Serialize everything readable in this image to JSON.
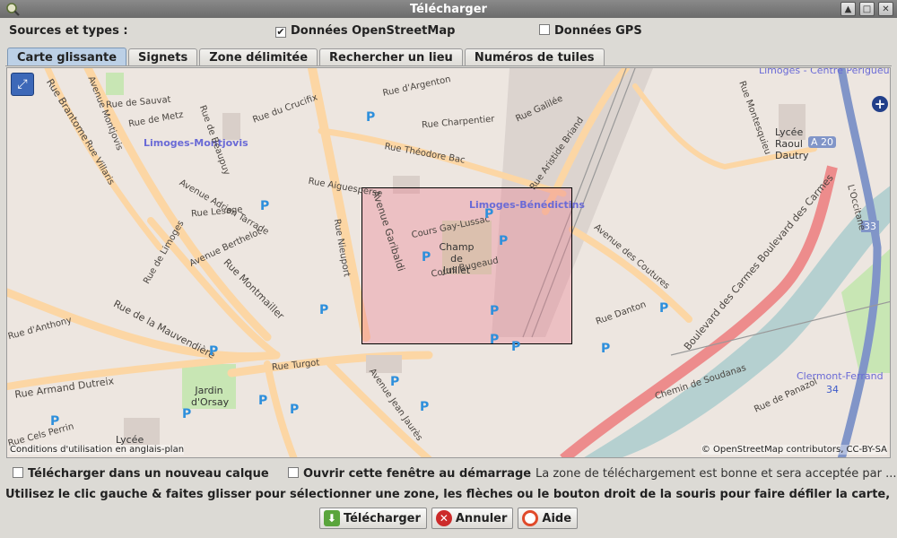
{
  "window": {
    "title": "Télécharger"
  },
  "sources": {
    "label": "Sources et types :",
    "osm": {
      "label": "Données OpenStreetMap",
      "checked": true
    },
    "gps": {
      "label": "Données GPS",
      "checked": false
    }
  },
  "tabs": [
    {
      "label": "Carte glissante",
      "active": true
    },
    {
      "label": "Signets"
    },
    {
      "label": "Zone délimitée"
    },
    {
      "label": "Rechercher un lieu"
    },
    {
      "label": "Numéros de tuiles"
    }
  ],
  "map": {
    "places": {
      "montjovis": "Limoges-Montjovis",
      "benedictins": "Limoges-Bénédictins",
      "perigueux": "Limoges - Centre Périgueux",
      "clermont": "Clermont-Ferrand"
    },
    "labels": {
      "champ": "Champ de Juillet",
      "jardin": "Jardin d'Orsay",
      "lycee_raoul": "Lycée Raoul Dautry",
      "lycee": "Lycée",
      "a20": "A 20",
      "r33": "33",
      "r34": "34"
    },
    "streets": {
      "brantome": "Rue Brantome",
      "montjovis": "Avenue Montjovis",
      "montmailler": "Rue Montmailler",
      "mauvendiere": "Rue de la Mauvendière",
      "armand": "Rue Armand Dutreix",
      "garibaldi": "Avenue Garibaldi",
      "theodore": "Rue Théodore Bac",
      "aristide": "Rue Aristide Briand",
      "gay_lussac": "Cours Gay-Lussac",
      "bugeaud": "Cours Bugeaud",
      "couture": "Avenue des Coutures",
      "carmes": "Boulevard des Carmes Boulevard des Carmes",
      "turgot": "Rue Turgot",
      "jean_jaures": "Avenue Jean Jaurès",
      "soudanas": "Chemin de Soudanas",
      "panazol": "Rue de Panazol",
      "occitane": "L'Occitane",
      "anthony": "Rue d'Anthony",
      "perrin": "Rue Cels Perrin",
      "limoges": "Rue de Limoges",
      "aiguesperse": "Rue Aiguesperse",
      "argenton": "Rue d'Argenton",
      "charpentier": "Rue Charpentier",
      "galilee": "Rue Galilée",
      "crucifix": "Rue du Crucifix",
      "beaupuy": "Rue de Beaupuy",
      "danton": "Rue Danton",
      "montesquieu": "Rue Montesquieu",
      "metz": "Rue de Metz",
      "sauvat": "Rue de Sauvat",
      "turgot2": "Avenue Adrien Tarrade",
      "berthelot": "Avenue Berthelot",
      "lesage": "Rue Lesage",
      "villaris": "Rue Villaris",
      "nieuport": "Rue Nieuport"
    },
    "attribution_left": "Conditions d'utilisation en anglais-plan",
    "attribution_right": "© OpenStreetMap contributors, CC-BY-SA"
  },
  "options": {
    "new_layer": {
      "label": "Télécharger dans un nouveau calque",
      "checked": false
    },
    "open_startup": {
      "label": "Ouvrir cette fenêtre au démarrage",
      "checked": false
    },
    "status": "La zone de téléchargement est bonne et sera acceptée par ..."
  },
  "instructions": "Utilisez le clic gauche & faites glisser pour sélectionner une zone, les flèches ou le bouton droit de la souris pour faire défiler la carte, la ...",
  "buttons": {
    "download": "Télécharger",
    "cancel": "Annuler",
    "help": "Aide"
  },
  "colors": {
    "selection": "#e8788c",
    "major_road": "#fcd6a4",
    "trunk": "#ed8c8c",
    "motorway": "#8195c8",
    "river": "#b5d0d0",
    "park": "#c8e6b4"
  }
}
